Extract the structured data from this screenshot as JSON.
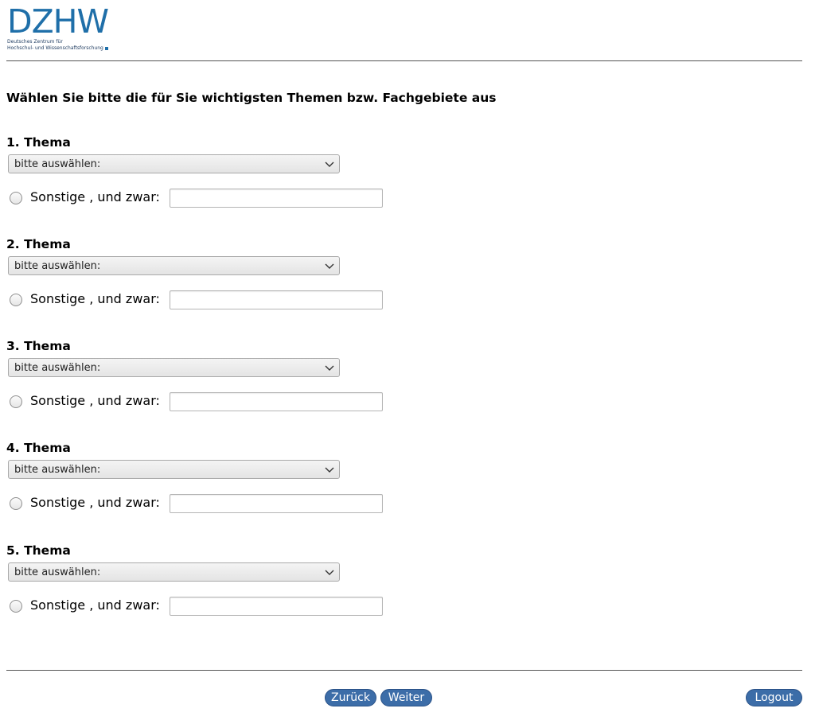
{
  "header": {
    "logo_text": "DZHW",
    "logo_subtitle_line1": "Deutsches Zentrum für",
    "logo_subtitle_line2": "Hochschul- und Wissenschaftsforschung"
  },
  "question": {
    "title": "Wählen Sie bitte die für Sie wichtigsten Themen bzw. Fachgebiete aus"
  },
  "topics": [
    {
      "heading": "1. Thema",
      "select_value": "bitte auswählen:",
      "other_label": "Sonstige , und zwar:",
      "other_value": ""
    },
    {
      "heading": "2. Thema",
      "select_value": "bitte auswählen:",
      "other_label": "Sonstige , und zwar:",
      "other_value": ""
    },
    {
      "heading": "3. Thema",
      "select_value": "bitte auswählen:",
      "other_label": "Sonstige , und zwar:",
      "other_value": ""
    },
    {
      "heading": "4. Thema",
      "select_value": "bitte auswählen:",
      "other_label": "Sonstige , und zwar:",
      "other_value": ""
    },
    {
      "heading": "5. Thema",
      "select_value": "bitte auswählen:",
      "other_label": "Sonstige , und zwar:",
      "other_value": ""
    }
  ],
  "footer": {
    "back_label": "Zurück",
    "next_label": "Weiter",
    "logout_label": "Logout"
  },
  "colors": {
    "brand": "#1f6fa9",
    "button": "#3c6da8"
  }
}
